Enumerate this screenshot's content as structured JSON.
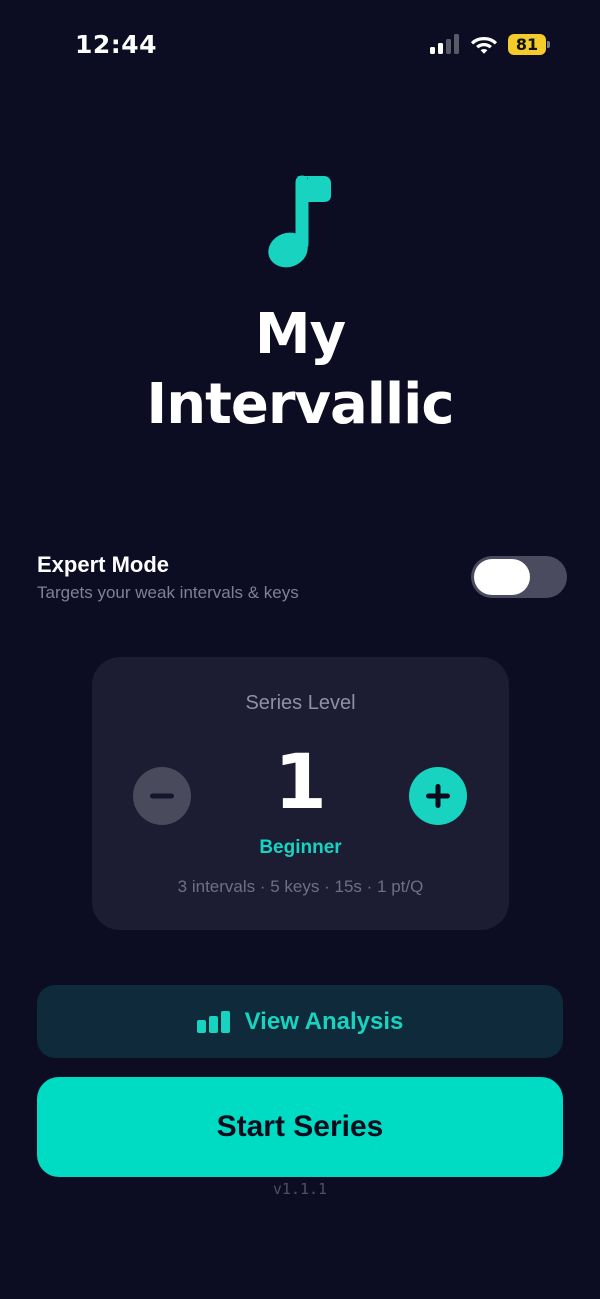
{
  "status_bar": {
    "time": "12:44",
    "battery_level": "81",
    "battery_color": "#f3cb2a",
    "icons": [
      "signal-icon",
      "wifi-icon",
      "battery-icon"
    ]
  },
  "header": {
    "logo_icon": "music-note-icon",
    "title_line1": "My",
    "title_line2": "Intervallic"
  },
  "expert_mode": {
    "title": "Expert Mode",
    "subtitle": "Targets your weak intervals & keys",
    "enabled": false
  },
  "level": {
    "label": "Series Level",
    "value": "1",
    "name": "Beginner",
    "details": "3 intervals · 5 keys · 15s · 1 pt/Q",
    "decrease_icon": "minus-icon",
    "increase_icon": "plus-icon"
  },
  "actions": {
    "analysis_label": "View Analysis",
    "analysis_icon": "bar-chart-icon",
    "start_label": "Start Series"
  },
  "footer": {
    "version": "v1.1.1"
  },
  "colors": {
    "background": "#0c0c22",
    "accent": "#17d3bf",
    "primary_button": "#00dcc4",
    "card": "#1c1c33"
  }
}
